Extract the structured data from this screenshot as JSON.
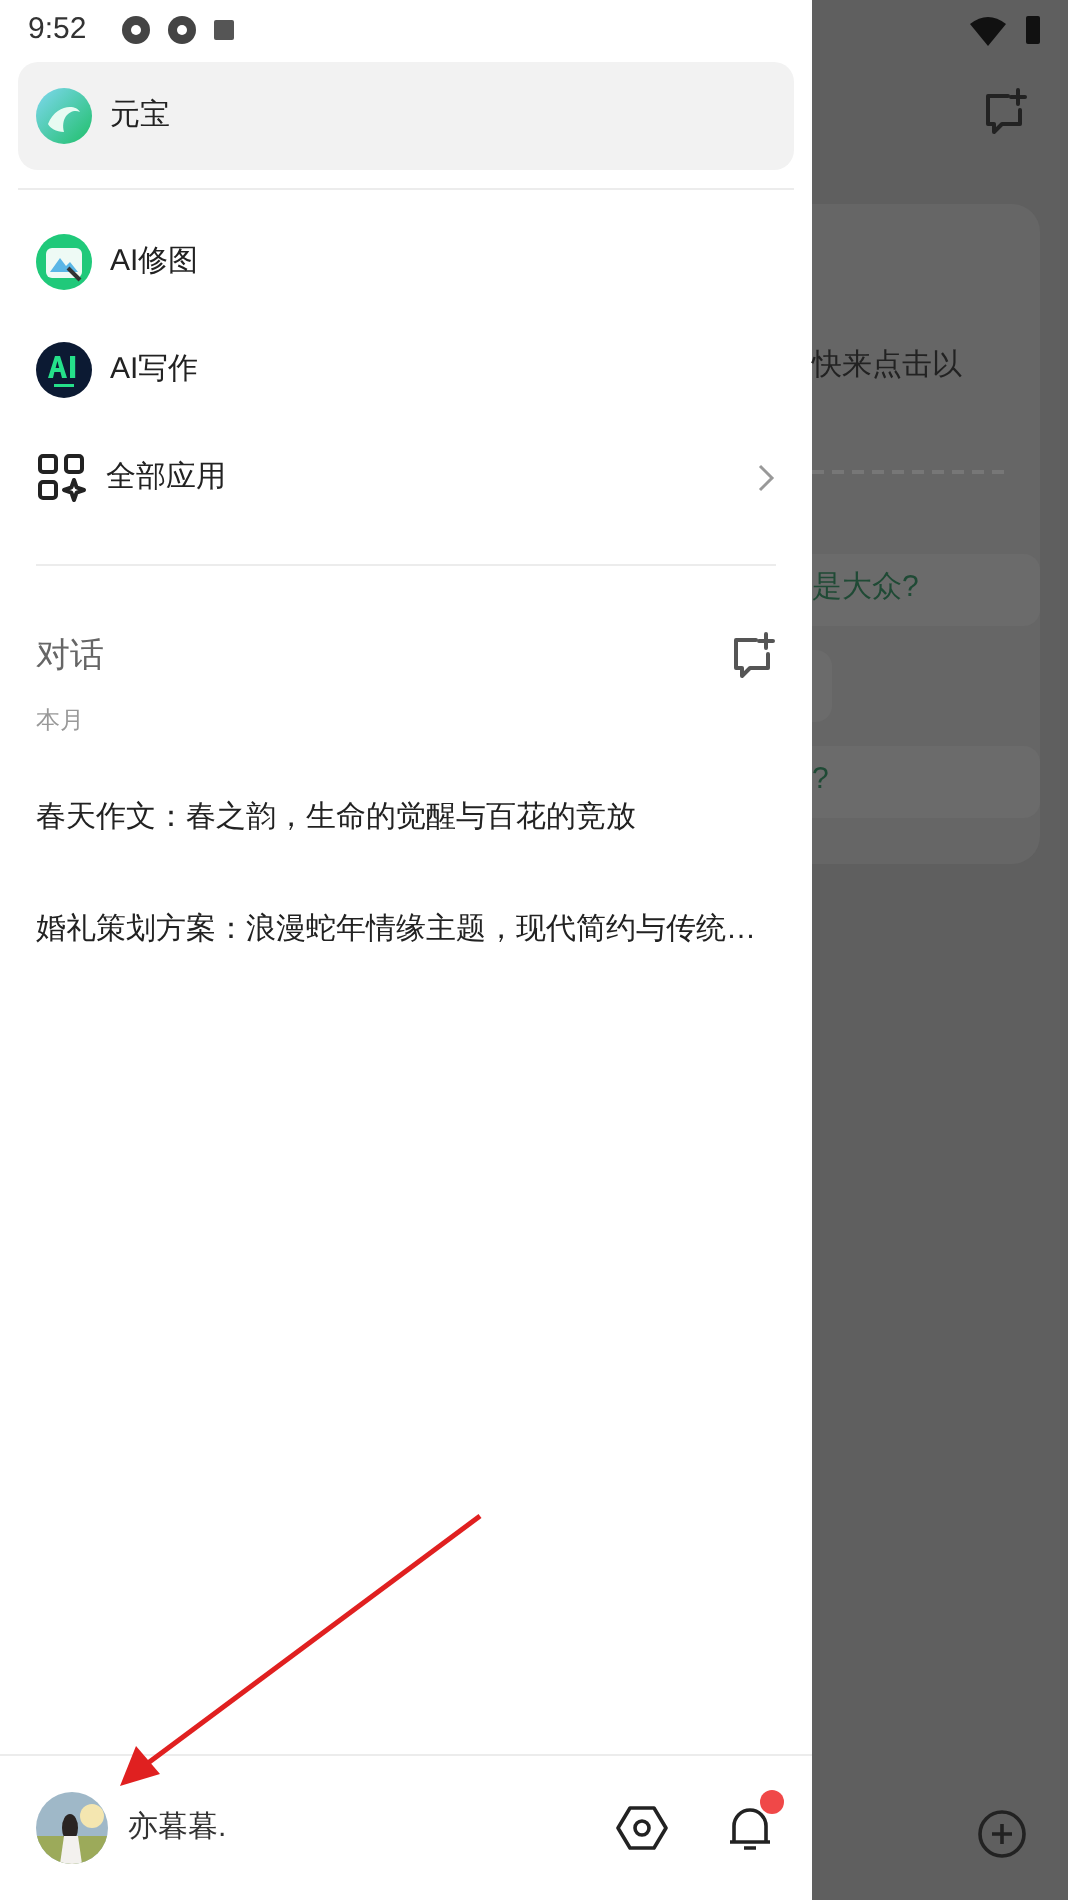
{
  "status_bar": {
    "time": "9:52"
  },
  "drawer": {
    "apps": [
      {
        "label": "元宝",
        "kind": "yuanbao",
        "selected": true
      },
      {
        "label": "AI修图",
        "kind": "photo",
        "selected": false
      },
      {
        "label": "AI写作",
        "kind": "writing",
        "selected": false
      },
      {
        "label": "全部应用",
        "kind": "all",
        "selected": false
      }
    ],
    "conversations": {
      "title": "对话",
      "groups": [
        {
          "label": "本月",
          "items": [
            "春天作文：春之韵，生命的觉醒与百花的竞放",
            "婚礼策划方案：浪漫蛇年情缘主题，现代简约与传统…"
          ]
        }
      ]
    },
    "user": {
      "name": "亦暮暮.",
      "has_notification": true
    }
  },
  "background": {
    "card_text": "快来点击以",
    "chips": [
      {
        "kind": "text",
        "label": "是大众?"
      },
      {
        "kind": "empty"
      },
      {
        "kind": "text",
        "label": "?"
      }
    ]
  }
}
